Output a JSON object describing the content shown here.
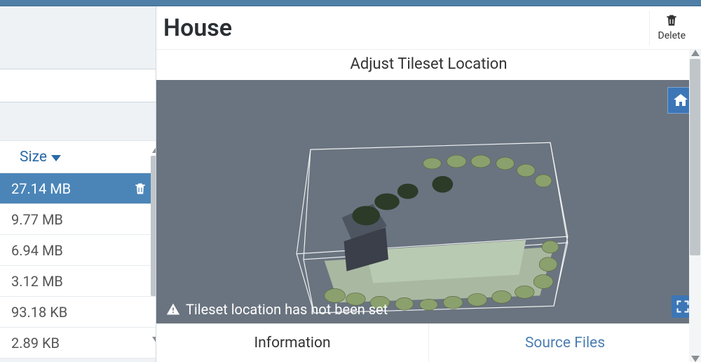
{
  "header": {
    "title": "House",
    "delete_label": "Delete",
    "section_title": "Adjust Tileset Location"
  },
  "search": {
    "placeholder": ""
  },
  "list": {
    "sort_label": "Size",
    "items": [
      {
        "size": "27.14 MB",
        "selected": true
      },
      {
        "size": "9.77 MB",
        "selected": false
      },
      {
        "size": "6.94 MB",
        "selected": false
      },
      {
        "size": "3.12 MB",
        "selected": false
      },
      {
        "size": "93.18 KB",
        "selected": false
      },
      {
        "size": "2.89 KB",
        "selected": false
      }
    ]
  },
  "viewer": {
    "warning": "Tileset location has not been set"
  },
  "tabs": {
    "items": [
      {
        "label": "Information",
        "active": true
      },
      {
        "label": "Source Files",
        "active": false
      }
    ]
  },
  "icons": {
    "search": "search-icon",
    "trash": "trash-icon",
    "home": "home-icon",
    "fullscreen": "expand-icon",
    "warning": "warning-icon"
  }
}
